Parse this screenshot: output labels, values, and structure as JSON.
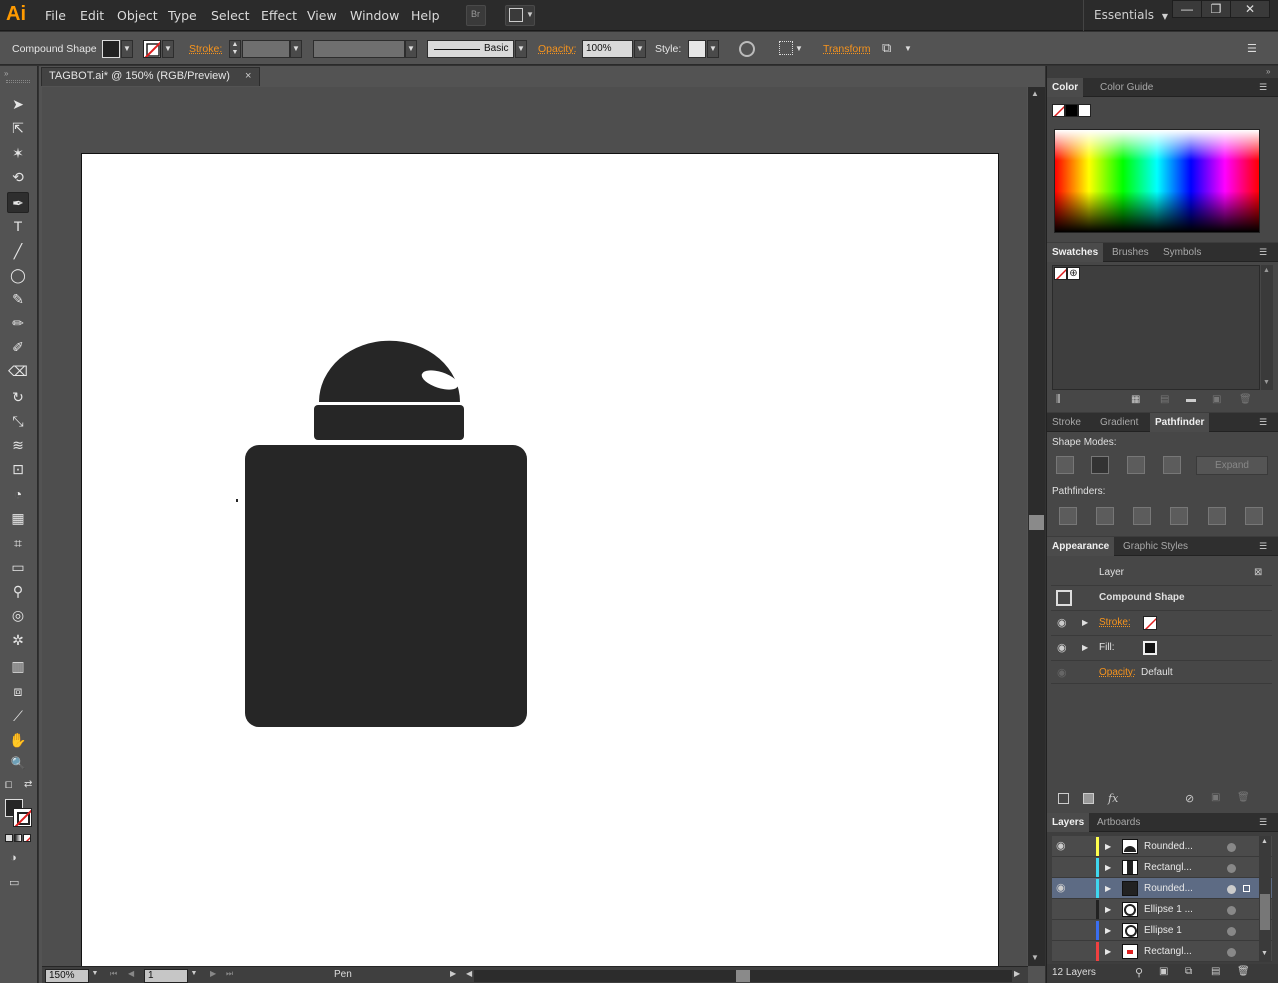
{
  "app": {
    "logo": "Ai",
    "menu": [
      "File",
      "Edit",
      "Object",
      "Type",
      "Select",
      "Effect",
      "View",
      "Window",
      "Help"
    ],
    "workspace": "Essentials",
    "window_controls": [
      "—",
      "❐",
      "✕"
    ]
  },
  "controlbar": {
    "object_type": "Compound Shape",
    "stroke_label": "Stroke:",
    "brush_label": "Basic",
    "opacity_label": "Opacity:",
    "opacity_value": "100%",
    "style_label": "Style:",
    "transform_label": "Transform"
  },
  "document": {
    "tab_title": "TAGBOT.ai* @ 150% (RGB/Preview)",
    "tab_close": "×",
    "zoom": "150%",
    "artboard_number": "1",
    "status_tool": "Pen",
    "fill_color": "#262626"
  },
  "toolbox": {
    "tools": [
      "selection-icon",
      "direct-selection-icon",
      "magic-wand-icon",
      "lasso-icon",
      "pen-icon",
      "type-icon",
      "line-icon",
      "ellipse-icon",
      "paintbrush-icon",
      "pencil-icon",
      "blob-brush-icon",
      "eraser-icon",
      "rotate-icon",
      "scale-icon",
      "warp-icon",
      "free-transform-icon",
      "shape-builder-icon",
      "perspective-grid-icon",
      "mesh-icon",
      "gradient-icon",
      "eyedropper-icon",
      "blend-icon",
      "symbol-sprayer-icon",
      "column-graph-icon",
      "artboard-icon",
      "slice-icon",
      "hand-icon",
      "zoom-icon"
    ],
    "glyphs": [
      "➤",
      "⇱",
      "✶",
      "⟲",
      "✒",
      "T",
      "╱",
      "◯",
      "✎",
      "✏",
      "✐",
      "⌫",
      "↻",
      "⤡",
      "≋",
      "⊡",
      "◔",
      "▦",
      "⌗",
      "▭",
      "⚲",
      "◎",
      "✲",
      "▥",
      "⧈",
      "⟋",
      "✋",
      "🔍"
    ]
  },
  "panels": {
    "color": {
      "tabs": [
        "Color",
        "Color Guide"
      ]
    },
    "swatches": {
      "tabs": [
        "Swatches",
        "Brushes",
        "Symbols"
      ]
    },
    "pathfinder": {
      "tabs": [
        "Stroke",
        "Gradient",
        "Pathfinder"
      ],
      "shape_modes_label": "Shape Modes:",
      "pathfinders_label": "Pathfinders:",
      "expand_label": "Expand"
    },
    "appearance": {
      "tabs": [
        "Appearance",
        "Graphic Styles"
      ],
      "layer_label": "Layer",
      "object_label": "Compound Shape",
      "stroke_label": "Stroke:",
      "fill_label": "Fill:",
      "opacity_label": "Opacity:",
      "opacity_value": "Default",
      "fx_label": "fx"
    },
    "layers": {
      "tabs": [
        "Layers",
        "Artboards"
      ],
      "count_label": "12 Layers",
      "rows": [
        {
          "name": "Rounded...",
          "color": "#ffff4d",
          "visible": true
        },
        {
          "name": "Rectangl...",
          "color": "#3fd7f0",
          "visible": false
        },
        {
          "name": "Rounded...",
          "color": "#3fd7f0",
          "visible": true
        },
        {
          "name": "Ellipse 1 ...",
          "color": "#222222",
          "visible": false
        },
        {
          "name": "Ellipse 1",
          "color": "#3a6ef0",
          "visible": false
        },
        {
          "name": "Rectangl...",
          "color": "#f04040",
          "visible": false
        }
      ]
    }
  }
}
